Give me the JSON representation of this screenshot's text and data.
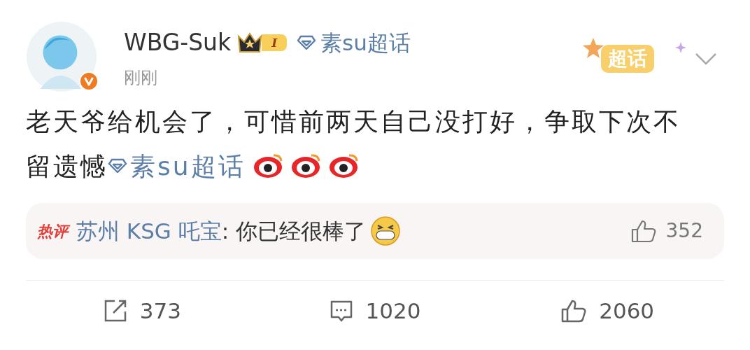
{
  "author": {
    "name": "WBG-Suk",
    "verified": true,
    "badge": "I",
    "topic": "素su超话"
  },
  "sticker": "超话",
  "time": "刚刚",
  "post": {
    "text": "老天爷给机会了，可惜前两天自己没打好，争取下次不留遗憾",
    "topic": "素su超话",
    "emojis": [
      {
        "kind": "weibo-eye"
      },
      {
        "kind": "weibo-eye"
      },
      {
        "kind": "weibo-eye"
      }
    ]
  },
  "hot_comment": {
    "tag": "热评",
    "user": "苏州 KSG 吒宝",
    "text": ": 你已经很棒了",
    "emojis": [
      {
        "kind": "grin"
      }
    ],
    "likes": "352"
  },
  "actions": [
    {
      "kind": "repost",
      "count": "373"
    },
    {
      "kind": "comment",
      "count": "1020"
    },
    {
      "kind": "like",
      "count": "2060"
    }
  ]
}
